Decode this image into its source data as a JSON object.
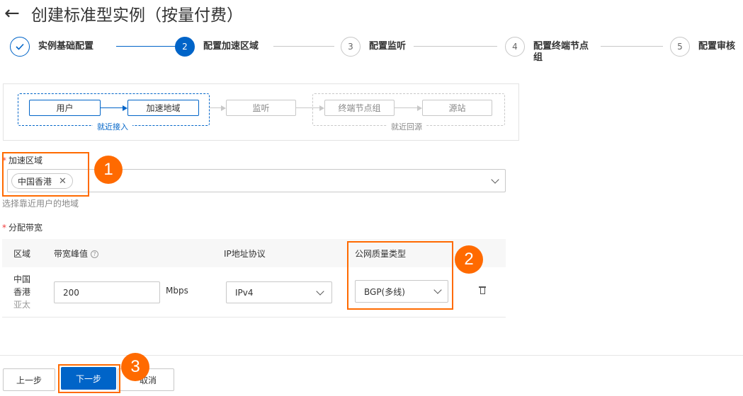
{
  "header": {
    "title": "创建标准型实例（按量付费）"
  },
  "steps": [
    {
      "number": "",
      "label": "实例基础配置"
    },
    {
      "number": "2",
      "label": "配置加速区域"
    },
    {
      "number": "3",
      "label": "配置监听"
    },
    {
      "number": "4",
      "label": "配置终端节点组"
    },
    {
      "number": "5",
      "label": "配置审核"
    }
  ],
  "diagram": {
    "user": "用户",
    "accel_region": "加速地域",
    "listener": "监听",
    "endpoint_group": "终端节点组",
    "origin": "源站",
    "nearby_access": "就近接入",
    "nearby_origin": "就近回源"
  },
  "region_field": {
    "label": "加速区域",
    "tag": "中国香港",
    "helper": "选择靠近用户的地域"
  },
  "bandwidth": {
    "label": "分配带宽",
    "columns": [
      "区域",
      "带宽峰值",
      "IP地址协议",
      "公网质量类型"
    ],
    "row": {
      "region_line1": "中国",
      "region_line2": "香港",
      "region_sub": "亚太",
      "bandwidth_value": "200",
      "unit": "Mbps",
      "ip_protocol": "IPv4",
      "quality_type": "BGP(多线)"
    }
  },
  "footer": {
    "prev_label": "上一步",
    "next_label": "下一步",
    "cancel_label": "取消"
  },
  "callouts": [
    "1",
    "2",
    "3"
  ],
  "colors": {
    "primary": "#0064c8",
    "callout": "#ff6a00"
  }
}
